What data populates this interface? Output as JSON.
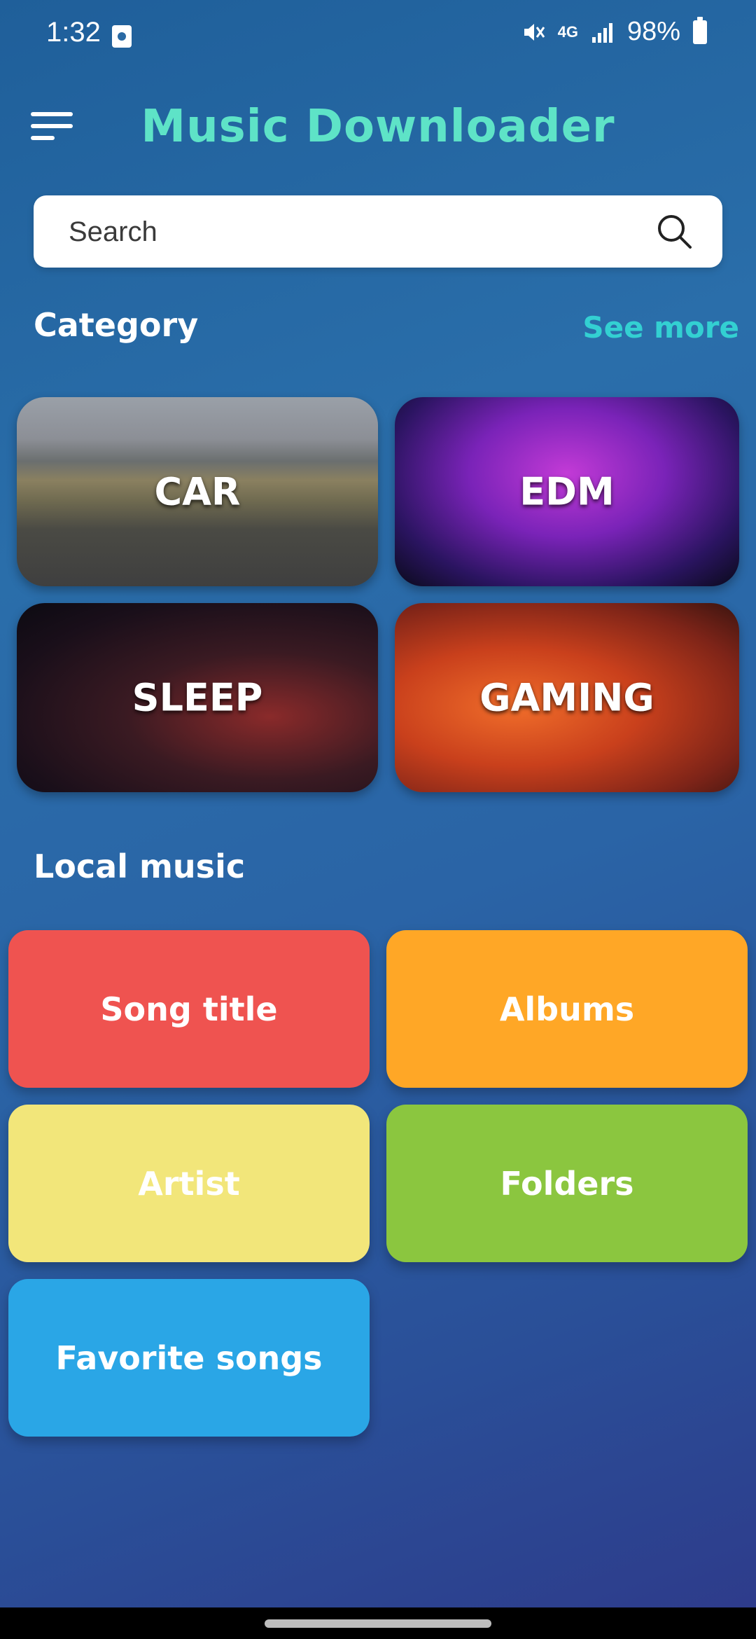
{
  "status_bar": {
    "time": "1:32",
    "network": "4G",
    "battery": "98%"
  },
  "header": {
    "title": "Music Downloader",
    "menu_icon": "menu-icon"
  },
  "search": {
    "placeholder": "Search",
    "icon": "search-icon"
  },
  "category_section": {
    "title": "Category",
    "see_more": "See more",
    "items": [
      {
        "label": "CAR"
      },
      {
        "label": "EDM"
      },
      {
        "label": "SLEEP"
      },
      {
        "label": "GAMING"
      }
    ]
  },
  "local_music": {
    "title": "Local music",
    "items": [
      {
        "label": "Song title",
        "color": "#ef5350"
      },
      {
        "label": "Albums",
        "color": "#ffa726"
      },
      {
        "label": "Artist",
        "color": "#f2e67a"
      },
      {
        "label": "Folders",
        "color": "#8bc63f"
      },
      {
        "label": "Favorite songs",
        "color": "#2aa6e6"
      }
    ]
  },
  "colors": {
    "title_accent": "#5ee3c7",
    "link_accent": "#33d0d2"
  }
}
